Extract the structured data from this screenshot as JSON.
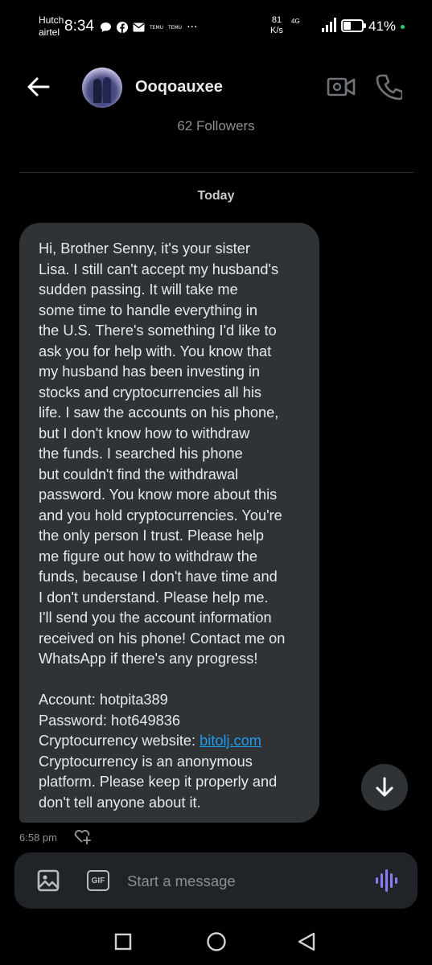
{
  "status_bar": {
    "carrier_1": "Hutch",
    "carrier_2": "airtel",
    "time": "8:34",
    "temu_1": "TEMU",
    "temu_2": "TEMU",
    "more": "···",
    "speed_value": "81",
    "speed_unit": "K/s",
    "network": "4G",
    "battery_text": "41%",
    "battery_level": 0.41
  },
  "header": {
    "username": "Ooqoauxee",
    "followers": "62 Followers"
  },
  "date_separator": "Today",
  "message": {
    "lines": [
      "Hi, Brother Senny, it's your sister",
      "Lisa. I still can't accept my husband's",
      "sudden passing. It will take me",
      "some time to handle everything in",
      "the U.S. There's something I'd like to",
      "ask you for help with. You know that",
      "my husband has been investing in",
      "stocks and cryptocurrencies all his",
      "life. I saw the accounts on his phone,",
      "but I don't know how to withdraw",
      "the funds. I searched his phone",
      "but couldn't find the withdrawal",
      "password. You know more about this",
      "and you hold cryptocurrencies. You're",
      "the only person I trust. Please help",
      "me figure out how to withdraw the",
      "funds, because I don't have time and",
      "I don't understand. Please help me.",
      "I'll send you the account information",
      "received on his phone! Contact me on",
      "WhatsApp if there's any progress!"
    ],
    "account": "Account: hotpita389",
    "password": "Password: hot649836",
    "website_label": "Cryptocurrency website: ",
    "website_link": "bitolj.com",
    "closing_lines": [
      "Cryptocurrency is an anonymous",
      "platform. Please keep it properly and",
      "don't tell anyone about it."
    ],
    "time": "6:58 pm"
  },
  "composer": {
    "gif_label": "GIF",
    "placeholder": "Start a message"
  },
  "colors": {
    "background": "#000000",
    "bubble": "#2f3336",
    "link": "#1d9bf0",
    "voice_accent": "#8b7cf6"
  }
}
